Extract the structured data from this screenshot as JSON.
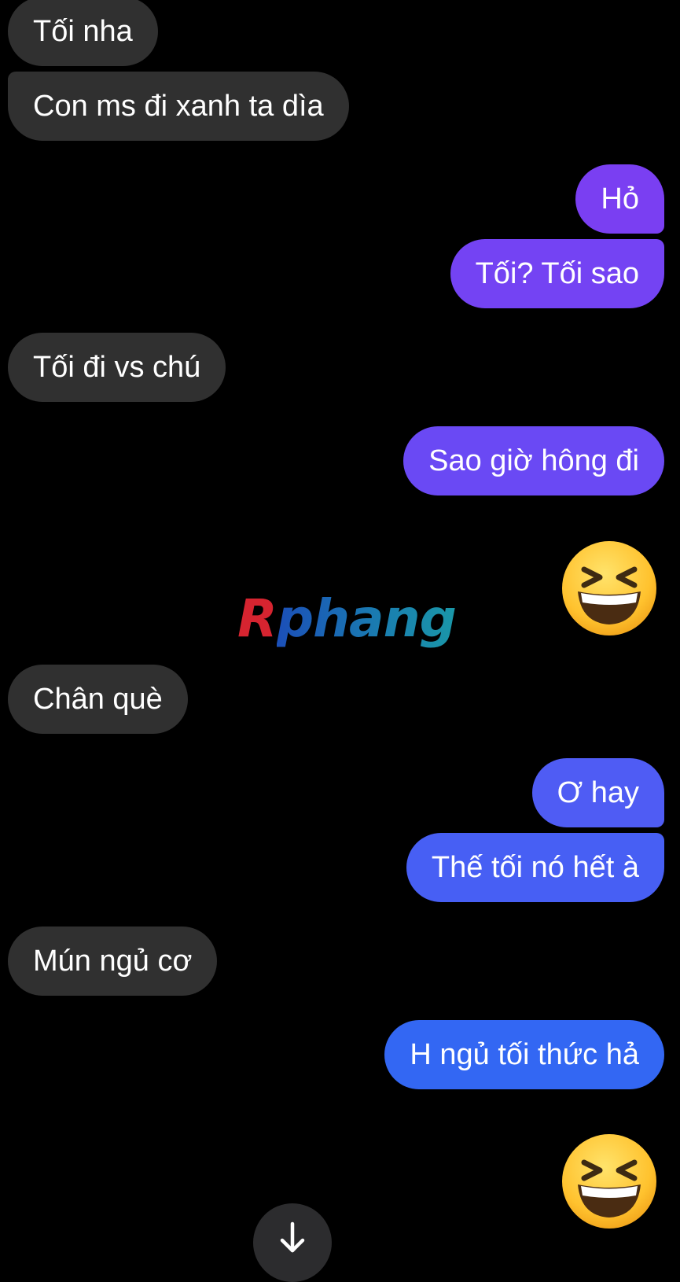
{
  "conversation": {
    "messages": [
      {
        "sender": "other",
        "text": "Tối nha"
      },
      {
        "sender": "other",
        "text": "Con ms đi xanh ta dìa"
      },
      {
        "sender": "me",
        "text": "Hỏ"
      },
      {
        "sender": "me",
        "text": "Tối? Tối sao"
      },
      {
        "sender": "other",
        "text": "Tối đi vs chú"
      },
      {
        "sender": "me",
        "text": "Sao giờ hông đi"
      },
      {
        "sender": "me",
        "emoji": "grinning-squinting-face"
      },
      {
        "sender": "other",
        "text": "Chân què"
      },
      {
        "sender": "me",
        "text": "Ơ hay"
      },
      {
        "sender": "me",
        "text": "Thế tối nó hết à"
      },
      {
        "sender": "other",
        "text": "Mún ngủ cơ"
      },
      {
        "sender": "me",
        "text": "H ngủ tối thức hả"
      },
      {
        "sender": "me",
        "emoji": "grinning-squinting-face"
      }
    ]
  },
  "watermark": {
    "text": "Rphang",
    "first_letter": "R",
    "rest": "phang"
  },
  "scroll_button": {
    "icon": "arrow-down-icon"
  },
  "colors": {
    "background": "#000000",
    "incoming_bubble": "#303030",
    "outgoing_top": "#7b3ff2",
    "outgoing_mid": "#5a55f4",
    "outgoing_bottom": "#3167f3",
    "watermark_red": "#d62430",
    "watermark_blue": "#1b4fb8",
    "watermark_teal": "#1a97a8"
  }
}
